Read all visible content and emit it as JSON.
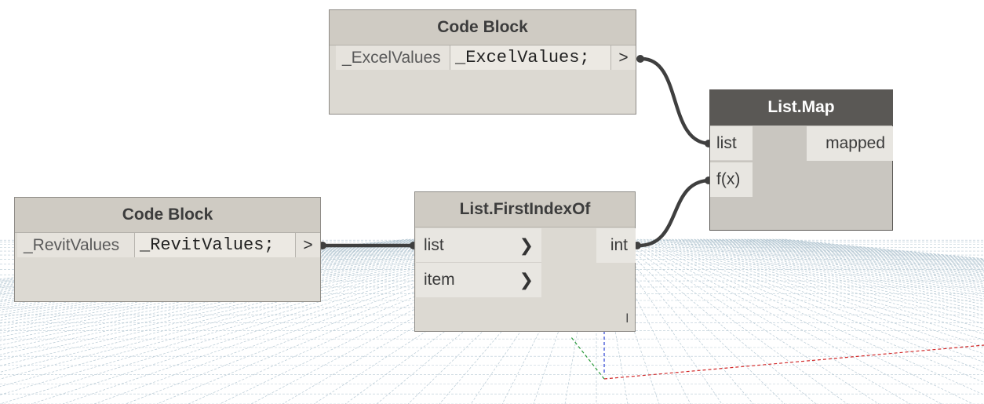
{
  "graph": {
    "excel_block": {
      "title": "Code Block",
      "input_name": "_ExcelValues",
      "code": "_ExcelValues;",
      "output": ">"
    },
    "revit_block": {
      "title": "Code Block",
      "input_name": "_RevitValues",
      "code": "_RevitValues;",
      "output": ">"
    },
    "first_index": {
      "title": "List.FirstIndexOf",
      "inputs": [
        {
          "label": "list",
          "arrow": "❯"
        },
        {
          "label": "item",
          "arrow": "❯"
        }
      ],
      "output": "int",
      "lacing": "l"
    },
    "list_map": {
      "title": "List.Map",
      "inputs": [
        {
          "label": "list"
        },
        {
          "label": "f(x)"
        }
      ],
      "output": "mapped"
    }
  },
  "colors": {
    "canvas_bg": "#ffffff",
    "grid_line": "#b7c9d4",
    "wire": "#3f3f3f",
    "node_body": "#dcd9d2",
    "selected_header": "#5a5855",
    "axis_red": "#d22a2a",
    "axis_green": "#2a9a3a",
    "axis_blue": "#2a3fd2"
  }
}
